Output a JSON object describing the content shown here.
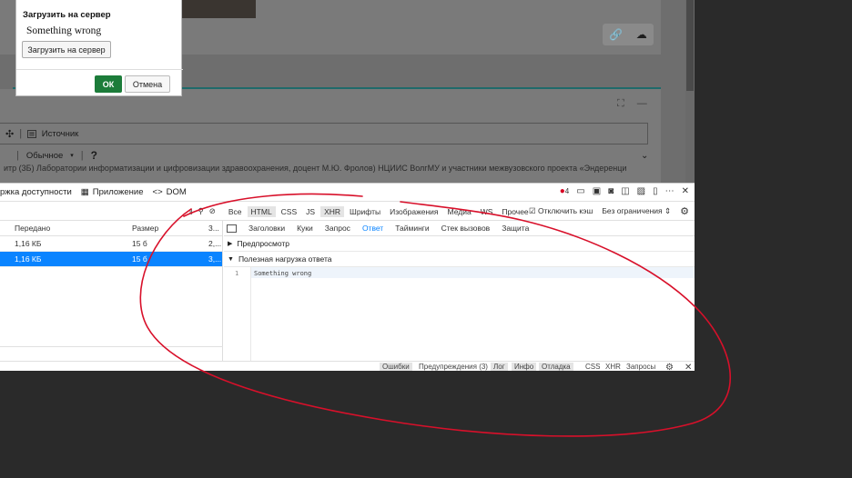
{
  "dialog": {
    "title": "Загрузить на сервер",
    "message": "Something wrong",
    "upload_button": "Загрузить на сервер",
    "ok_button": "ОК",
    "cancel_button": "Отмена"
  },
  "editor": {
    "toolbar1_source": "Источник",
    "format_select": "Обычное",
    "help": "?",
    "text_line": "итр (3Б) Лаборатории информатизации и цифровизации здравоохранения, доцент М.Ю. Фролов) НЦИИС ВолгМУ и участники межвузовского проекта «Эндеренци"
  },
  "devtools": {
    "top_tabs": [
      {
        "label": "ржка доступности"
      },
      {
        "label": "Приложение"
      },
      {
        "label": "DOM"
      }
    ],
    "error_count": "4",
    "filter_tabs": [
      {
        "label": "Все",
        "selected": false
      },
      {
        "label": "HTML",
        "selected": true
      },
      {
        "label": "CSS",
        "selected": false
      },
      {
        "label": "JS",
        "selected": false
      },
      {
        "label": "XHR",
        "selected": true
      },
      {
        "label": "Шрифты",
        "selected": false
      },
      {
        "label": "Изображения",
        "selected": false
      },
      {
        "label": "Медиа",
        "selected": false
      },
      {
        "label": "WS",
        "selected": false
      },
      {
        "label": "Прочее",
        "selected": false
      }
    ],
    "disable_cache": "Отключить кэш",
    "throttle": "Без ограничения",
    "list_columns": [
      "Передано",
      "Размер",
      "3..."
    ],
    "rows": [
      {
        "transferred": "1,16 КБ",
        "size": "15 б",
        "time": "2,...",
        "selected": false
      },
      {
        "transferred": "1,16 КБ",
        "size": "15 б",
        "time": "3,...",
        "selected": true
      }
    ],
    "detail_tabs": [
      {
        "label": "Заголовки",
        "selected": false
      },
      {
        "label": "Куки",
        "selected": false
      },
      {
        "label": "Запрос",
        "selected": false
      },
      {
        "label": "Ответ",
        "selected": true
      },
      {
        "label": "Тайминги",
        "selected": false
      },
      {
        "label": "Стек вызовов",
        "selected": false
      },
      {
        "label": "Защита",
        "selected": false
      }
    ],
    "preview_label": "Предпросмотр",
    "payload_label": "Полезная нагрузка ответа",
    "code_line_number": "1",
    "code_line_text": "Something wrong",
    "bottom_tabs": [
      {
        "label": "Ошибки",
        "selected": true
      },
      {
        "label": "Предупреждения (3)",
        "selected": false
      },
      {
        "label": "Лог",
        "selected": true
      },
      {
        "label": "Инфо",
        "selected": true
      },
      {
        "label": "Отладка",
        "selected": true
      },
      {
        "label": "CSS",
        "selected": false
      },
      {
        "label": "XHR",
        "selected": false
      },
      {
        "label": "Запросы",
        "selected": false
      }
    ]
  },
  "colors": {
    "accent_blue": "#0a84ff",
    "ok_green": "#1c7c3a",
    "annotation_red": "#d8102a",
    "error_red": "#d70022"
  }
}
